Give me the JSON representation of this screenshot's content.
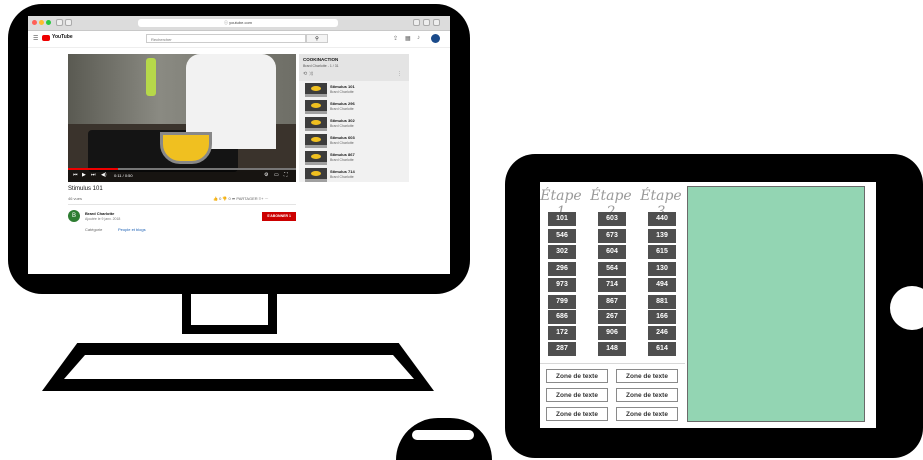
{
  "desktop": {
    "browser": {
      "url": "ⓘ youtube.com"
    },
    "youtube": {
      "logo_text": "YouTube",
      "menu_icon": "☰",
      "search_placeholder": "Rechercher",
      "search_icon": "⚲",
      "video": {
        "progress_fraction": 0.22,
        "time": "0:11 / 0:50",
        "title": "Stimulus  101",
        "views": "46 vues",
        "actions": "👍 0    👎 0    ➦ PARTAGER    ≡+    ⋯"
      },
      "channel": {
        "avatar_letter": "B",
        "name": "Brard Charlotte",
        "date": "Ajoutée le 9 janv. 2018",
        "subscribe": "S'ABONNER  1",
        "category_label": "Catégorie",
        "category_value": "People et blogs"
      },
      "playlist": {
        "title": "COOKINACTION",
        "subtitle": "Brard Charlotte - 1 / 31",
        "items": [
          {
            "name": "Stimulus 101",
            "author": "Brard Charlotte"
          },
          {
            "name": "Stimulus 296",
            "author": "Brard Charlotte"
          },
          {
            "name": "Stimulus 302",
            "author": "Brard Charlotte"
          },
          {
            "name": "Stimulus 603",
            "author": "Brard Charlotte"
          },
          {
            "name": "Stimulus 867",
            "author": "Brard Charlotte"
          },
          {
            "name": "Stimulus 714",
            "author": "Brard Charlotte"
          }
        ]
      }
    }
  },
  "tablet": {
    "steps": [
      {
        "label": "Étape 1",
        "numbers": [
          "101",
          "546",
          "302",
          "296",
          "973",
          "799",
          "686",
          "172",
          "287"
        ]
      },
      {
        "label": "Étape 2",
        "numbers": [
          "603",
          "673",
          "604",
          "564",
          "714",
          "867",
          "267",
          "906",
          "148"
        ]
      },
      {
        "label": "Étape 3",
        "numbers": [
          "440",
          "139",
          "615",
          "130",
          "494",
          "881",
          "166",
          "246",
          "614"
        ]
      }
    ],
    "text_zones": [
      "Zone de texte",
      "Zone de texte",
      "Zone de texte",
      "Zone de texte",
      "Zone de texte",
      "Zone de texte"
    ],
    "panel_color": "#93d5b3"
  }
}
